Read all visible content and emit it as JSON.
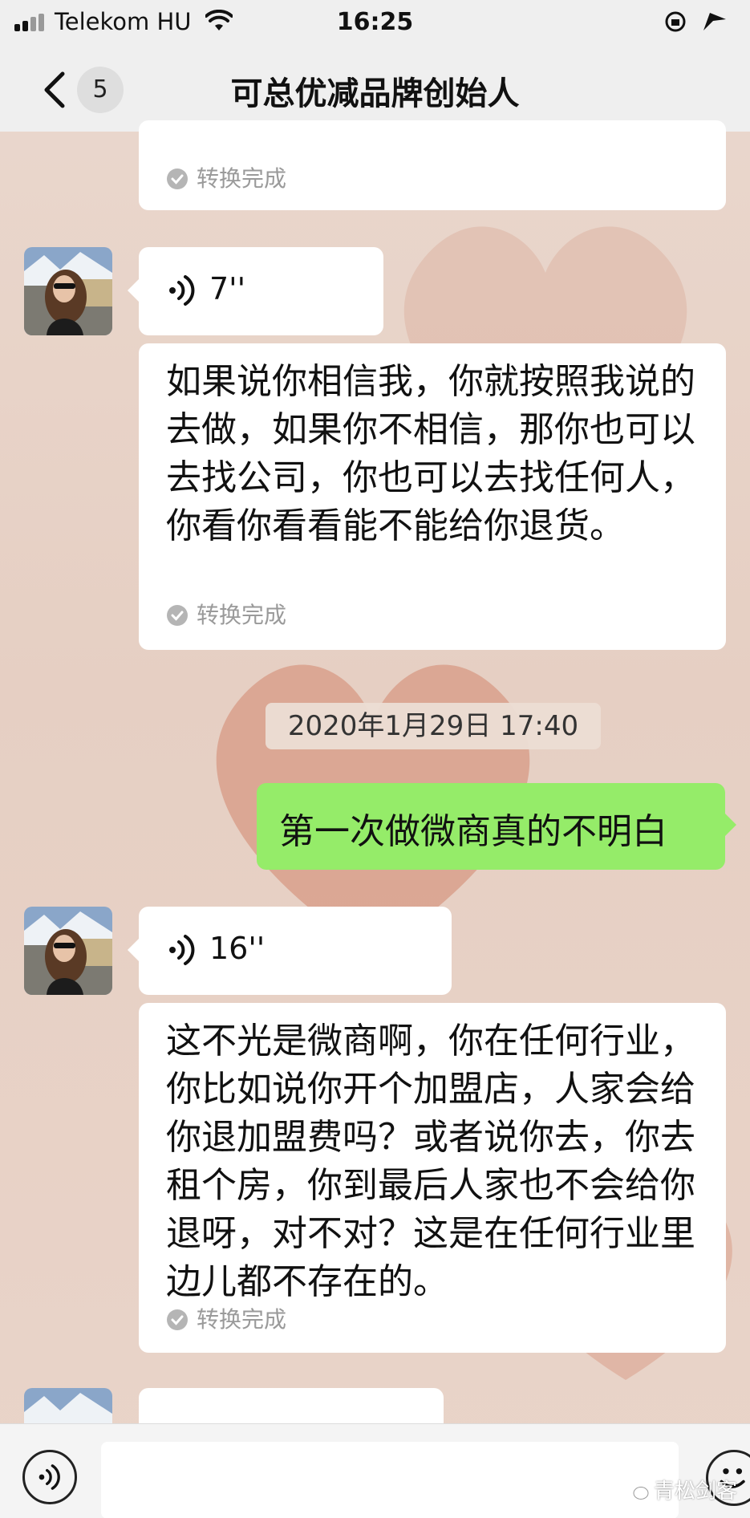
{
  "status_bar": {
    "carrier": "Telekom HU",
    "time": "16:25"
  },
  "nav": {
    "unread_count": "5",
    "title": "可总优减品牌创始人"
  },
  "messages": [
    {
      "type": "transcript-fragment",
      "status": "转换完成"
    },
    {
      "type": "voice",
      "sender": "contact",
      "duration": "7''",
      "transcript": "如果说你相信我，你就按照我说的去做，如果你不相信，那你也可以去找公司，你也可以去找任何人，你看你看看能不能给你退货。",
      "status": "转换完成"
    },
    {
      "type": "timestamp",
      "text": "2020年1月29日 17:40"
    },
    {
      "type": "text",
      "sender": "me",
      "text": "第一次做微商真的不明白"
    },
    {
      "type": "voice",
      "sender": "contact",
      "duration": "16''",
      "transcript": "这不光是微商啊，你在任何行业，你比如说你开个加盟店，人家会给你退加盟费吗？或者说你去，你去租个房，你到最后人家也不会给你退呀，对不对？这是在任何行业里边儿都不存在的。",
      "status": "转换完成"
    }
  ],
  "input_bar": {
    "placeholder": ""
  },
  "watermark": "青松剑客",
  "colors": {
    "sent_bubble": "#95ec69",
    "received_bubble": "#ffffff",
    "bar_background": "#efefef"
  }
}
